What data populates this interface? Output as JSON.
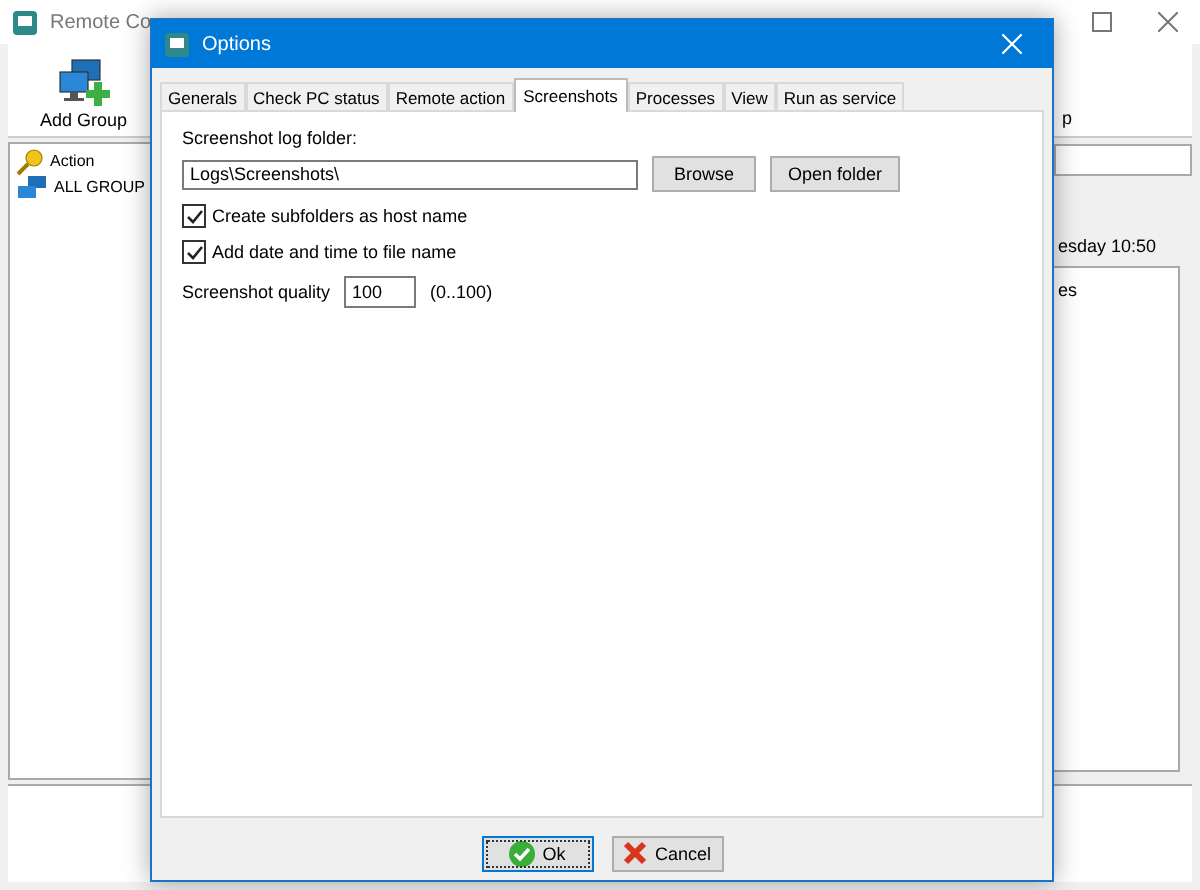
{
  "main_window": {
    "title": "Remote Co",
    "toolbar": [
      {
        "label": "Add Group",
        "kind": "add-group"
      },
      {
        "label": "p",
        "kind": "text"
      }
    ],
    "tree": [
      {
        "label": "Action",
        "kind": "action"
      },
      {
        "label": "ALL GROUP",
        "kind": "group"
      }
    ],
    "panel_date": "esday 10:50",
    "panel_column": "es"
  },
  "dialog": {
    "title": "Options",
    "tabs": [
      {
        "label": "Generals",
        "selected": false
      },
      {
        "label": "Check PC status",
        "selected": false
      },
      {
        "label": "Remote action",
        "selected": false
      },
      {
        "label": "Screenshots",
        "selected": true
      },
      {
        "label": "Processes",
        "selected": false
      },
      {
        "label": "View",
        "selected": false
      },
      {
        "label": "Run as service",
        "selected": false
      }
    ],
    "folder_label": "Screenshot log folder:",
    "folder_value": "Logs\\Screenshots\\",
    "folder_buttons": [
      "Browse",
      "Open folder"
    ],
    "options": [
      {
        "label": "Create subfolders as host name",
        "checked": true
      },
      {
        "label": "Add date and time to file name",
        "checked": true
      }
    ],
    "quality_label": "Screenshot quality",
    "quality_value": "100",
    "quality_range": "(0..100)",
    "footer_buttons": [
      {
        "label": "Ok",
        "kind": "ok"
      },
      {
        "label": "Cancel",
        "kind": "cancel"
      }
    ]
  }
}
